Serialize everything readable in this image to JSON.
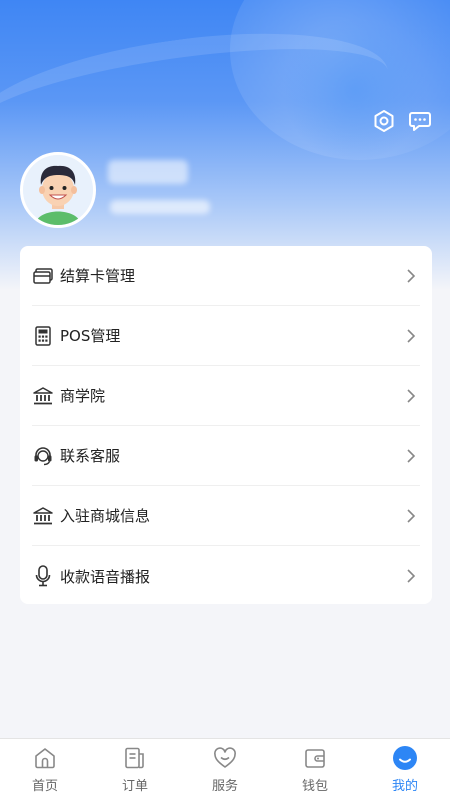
{
  "menu": {
    "items": [
      {
        "label": "结算卡管理",
        "icon": "card-icon"
      },
      {
        "label": "POS管理",
        "icon": "pos-terminal-icon"
      },
      {
        "label": "商学院",
        "icon": "bank-icon"
      },
      {
        "label": "联系客服",
        "icon": "headset-icon"
      },
      {
        "label": "入驻商城信息",
        "icon": "bank-icon"
      },
      {
        "label": "收款语音播报",
        "icon": "microphone-icon"
      }
    ]
  },
  "tabbar": {
    "items": [
      {
        "label": "首页",
        "icon": "home-icon"
      },
      {
        "label": "订单",
        "icon": "order-icon"
      },
      {
        "label": "服务",
        "icon": "heart-icon"
      },
      {
        "label": "钱包",
        "icon": "wallet-icon"
      },
      {
        "label": "我的",
        "icon": "profile-icon"
      }
    ],
    "active_index": 4
  },
  "colors": {
    "accent": "#2d86f5",
    "header_blue": "#3f86f4",
    "text": "#222222",
    "inactive_tab": "#666666"
  }
}
